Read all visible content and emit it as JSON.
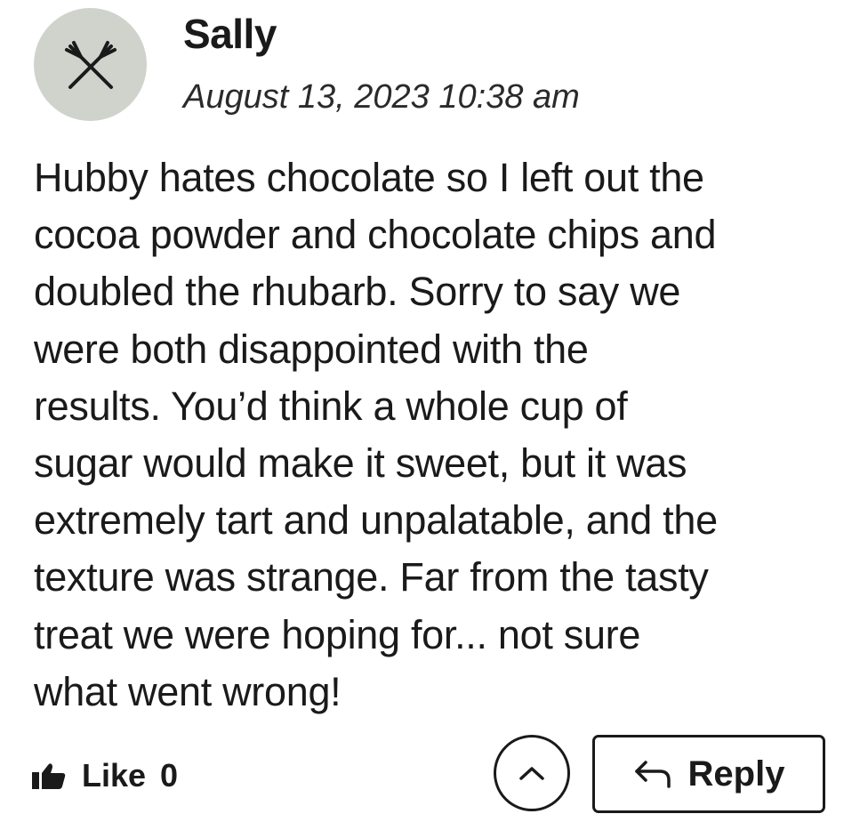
{
  "comment": {
    "author": "Sally",
    "timestamp": "August 13, 2023 10:38 am",
    "avatar_icon": "fork-knife-icon",
    "body": "Hubby hates chocolate so I left out the\ncocoa powder and chocolate chips and\ndoubled the rhubarb. Sorry to say we\nwere both disappointed with the\nresults. You’d think a whole cup of\nsugar would make it sweet, but it was\nextremely tart and unpalatable, and the\ntexture was strange. Far from the tasty\ntreat we were hoping for... not sure\nwhat went wrong!"
  },
  "actions": {
    "like_icon": "thumbs-up-icon",
    "like_label": "Like",
    "like_count": "0",
    "collapse_icon": "chevron-up-icon",
    "reply_icon": "reply-arrow-icon",
    "reply_label": "Reply"
  },
  "colors": {
    "avatar_bg": "#cfd3cc",
    "text": "#1a1a1a",
    "background": "#ffffff"
  }
}
